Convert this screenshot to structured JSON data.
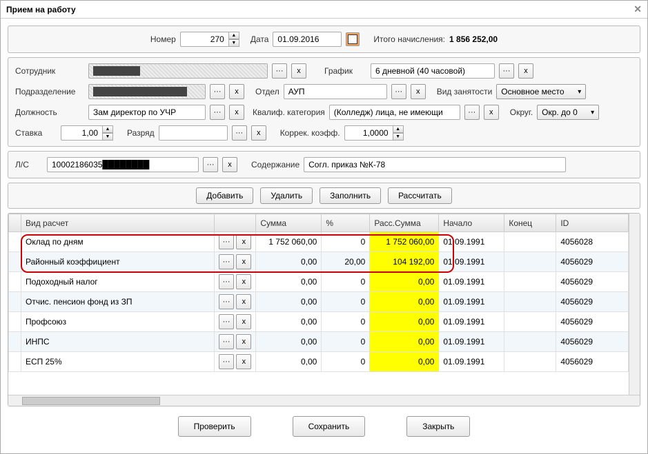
{
  "title": "Прием на работу",
  "header": {
    "number_label": "Номер",
    "number_value": "270",
    "date_label": "Дата",
    "date_value": "01.09.2016",
    "total_label": "Итого начисления:",
    "total_value": "1 856 252,00"
  },
  "form": {
    "employee_label": "Сотрудник",
    "employee_value": "████████",
    "schedule_label": "График",
    "schedule_value": "6 дневной (40 часовой)",
    "dept_label": "Подразделение",
    "dept_value": "████████████████",
    "otdel_label": "Отдел",
    "otdel_value": "АУП",
    "employment_label": "Вид занятости",
    "employment_value": "Основное место",
    "position_label": "Должность",
    "position_value": "Зам директор по УЧР",
    "qualif_label": "Квалиф. категория",
    "qualif_value": "(Колледж) лица, не имеющи",
    "round_label": "Округ.",
    "round_value": "Окр. до 0",
    "rate_label": "Ставка",
    "rate_value": "1,00",
    "rank_label": "Разряд",
    "rank_value": "",
    "coeff_label": "Коррек. коэфф.",
    "coeff_value": "1,0000",
    "account_label": "Л/С",
    "account_value": "10002186035████████",
    "desc_label": "Содержание",
    "desc_value": "Согл. приказ №К-78"
  },
  "toolbar": {
    "add": "Добавить",
    "delete": "Удалить",
    "fill": "Заполнить",
    "calc": "Рассчитать"
  },
  "columns": {
    "name": "Вид расчет",
    "sum": "Сумма",
    "pct": "%",
    "calc": "Расс.Сумма",
    "start": "Начало",
    "end": "Конец",
    "id": "ID"
  },
  "rows": [
    {
      "name": "Оклад по дням",
      "sum": "1 752 060,00",
      "pct": "0",
      "calc": "1 752 060,00",
      "start": "01.09.1991",
      "end": "",
      "id": "4056028"
    },
    {
      "name": "Районный коэффициент",
      "sum": "0,00",
      "pct": "20,00",
      "calc": "104 192,00",
      "start": "01.09.1991",
      "end": "",
      "id": "4056029"
    },
    {
      "name": "Подоходный налог",
      "sum": "0,00",
      "pct": "0",
      "calc": "0,00",
      "start": "01.09.1991",
      "end": "",
      "id": "4056029"
    },
    {
      "name": "Отчис. пенсион фонд из ЗП",
      "sum": "0,00",
      "pct": "0",
      "calc": "0,00",
      "start": "01.09.1991",
      "end": "",
      "id": "4056029"
    },
    {
      "name": "Профсоюз",
      "sum": "0,00",
      "pct": "0",
      "calc": "0,00",
      "start": "01.09.1991",
      "end": "",
      "id": "4056029"
    },
    {
      "name": "ИНПС",
      "sum": "0,00",
      "pct": "0",
      "calc": "0,00",
      "start": "01.09.1991",
      "end": "",
      "id": "4056029"
    },
    {
      "name": "ЕСП 25%",
      "sum": "0,00",
      "pct": "0",
      "calc": "0,00",
      "start": "01.09.1991",
      "end": "",
      "id": "4056029"
    }
  ],
  "footer": {
    "check": "Проверить",
    "save": "Сохранить",
    "close": "Закрыть"
  },
  "glyphs": {
    "dots": "···",
    "x": "x"
  }
}
